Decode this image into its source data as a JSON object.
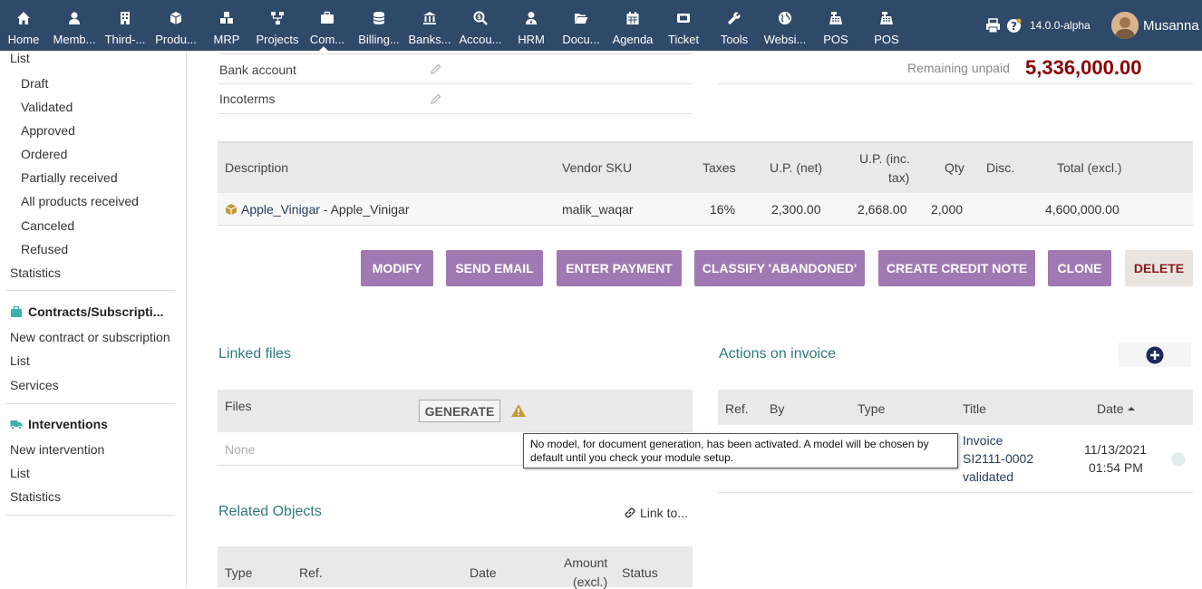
{
  "topbar": {
    "items": [
      {
        "label": "Home",
        "icon": "home-icon"
      },
      {
        "label": "Memb...",
        "icon": "user-icon"
      },
      {
        "label": "Third-...",
        "icon": "building-icon"
      },
      {
        "label": "Produ...",
        "icon": "cube-icon"
      },
      {
        "label": "MRP",
        "icon": "cubes-icon"
      },
      {
        "label": "Projects",
        "icon": "sitemap-icon"
      },
      {
        "label": "Com...",
        "icon": "briefcase-icon"
      },
      {
        "label": "Billing...",
        "icon": "coins-icon"
      },
      {
        "label": "Banks...",
        "icon": "bank-icon"
      },
      {
        "label": "Accou...",
        "icon": "search-dollar-icon"
      },
      {
        "label": "HRM",
        "icon": "user-tie-icon"
      },
      {
        "label": "Docu...",
        "icon": "folder-open-icon"
      },
      {
        "label": "Agenda",
        "icon": "calendar-icon"
      },
      {
        "label": "Ticket",
        "icon": "ticket-icon"
      },
      {
        "label": "Tools",
        "icon": "wrench-icon"
      },
      {
        "label": "Websi...",
        "icon": "globe-icon"
      },
      {
        "label": "POS",
        "icon": "cash-register-icon"
      },
      {
        "label": "POS",
        "icon": "cash-register-icon"
      }
    ],
    "version": "14.0.0-alpha",
    "username": "Musanna",
    "bar_color": "#2f4969"
  },
  "sidebar": {
    "list_label": "List",
    "orders": [
      "Draft",
      "Validated",
      "Approved",
      "Ordered",
      "Partially received",
      "All products received",
      "Canceled",
      "Refused"
    ],
    "statistics": "Statistics",
    "contracts": {
      "title": "Contracts/Subscripti...",
      "items": [
        "New contract or subscription",
        "List",
        "Services"
      ]
    },
    "interventions": {
      "title": "Interventions",
      "items": [
        "New intervention",
        "List",
        "Statistics"
      ]
    }
  },
  "fields": {
    "bank_account": "Bank account",
    "incoterms": "Incoterms"
  },
  "summary": {
    "remaining_label": "Remaining unpaid",
    "remaining_value": "5,336,000.00"
  },
  "lines": {
    "headers": {
      "description": "Description",
      "vendor_sku": "Vendor SKU",
      "taxes": "Taxes",
      "up_net": "U.P. (net)",
      "up_inc_1": "U.P. (inc.",
      "up_inc_2": "tax)",
      "qty": "Qty",
      "disc": "Disc.",
      "total": "Total (excl.)"
    },
    "row": {
      "product_ref": "Apple_Vinigar",
      "product_label": " - Apple_Vinigar",
      "vendor_sku": "malik_waqar",
      "taxes": "16%",
      "up_net": "2,300.00",
      "up_inc": "2,668.00",
      "qty": "2,000",
      "disc": "",
      "total": "4,600,000.00"
    }
  },
  "buttons": {
    "modify": "Modify",
    "send_email": "Send email",
    "enter_payment": "Enter payment",
    "classify": "Classify 'Abandoned'",
    "credit_note": "Create credit note",
    "clone": "Clone",
    "delete": "Delete",
    "accent": "#a079b3"
  },
  "linked_files": {
    "title": "Linked files",
    "files_label": "Files",
    "generate_label": "GENERATE",
    "none_label": "None",
    "tooltip": "No model, for document generation, has been activated. A model will be chosen by default until you check your module setup."
  },
  "actions": {
    "title": "Actions on invoice",
    "headers": {
      "ref": "Ref.",
      "by": "By",
      "type": "Type",
      "title": "Title",
      "date": "Date"
    },
    "row": {
      "title_1": "Invoice",
      "title_2": "SI2111-0002",
      "title_3": "validated",
      "date_1": "11/13/2021",
      "date_2": "01:54 PM"
    }
  },
  "related": {
    "title": "Related Objects",
    "link_to": "Link to...",
    "headers": {
      "type": "Type",
      "ref": "Ref.",
      "date": "Date",
      "amount_1": "Amount",
      "amount_2": "(excl.)",
      "status": "Status"
    }
  }
}
